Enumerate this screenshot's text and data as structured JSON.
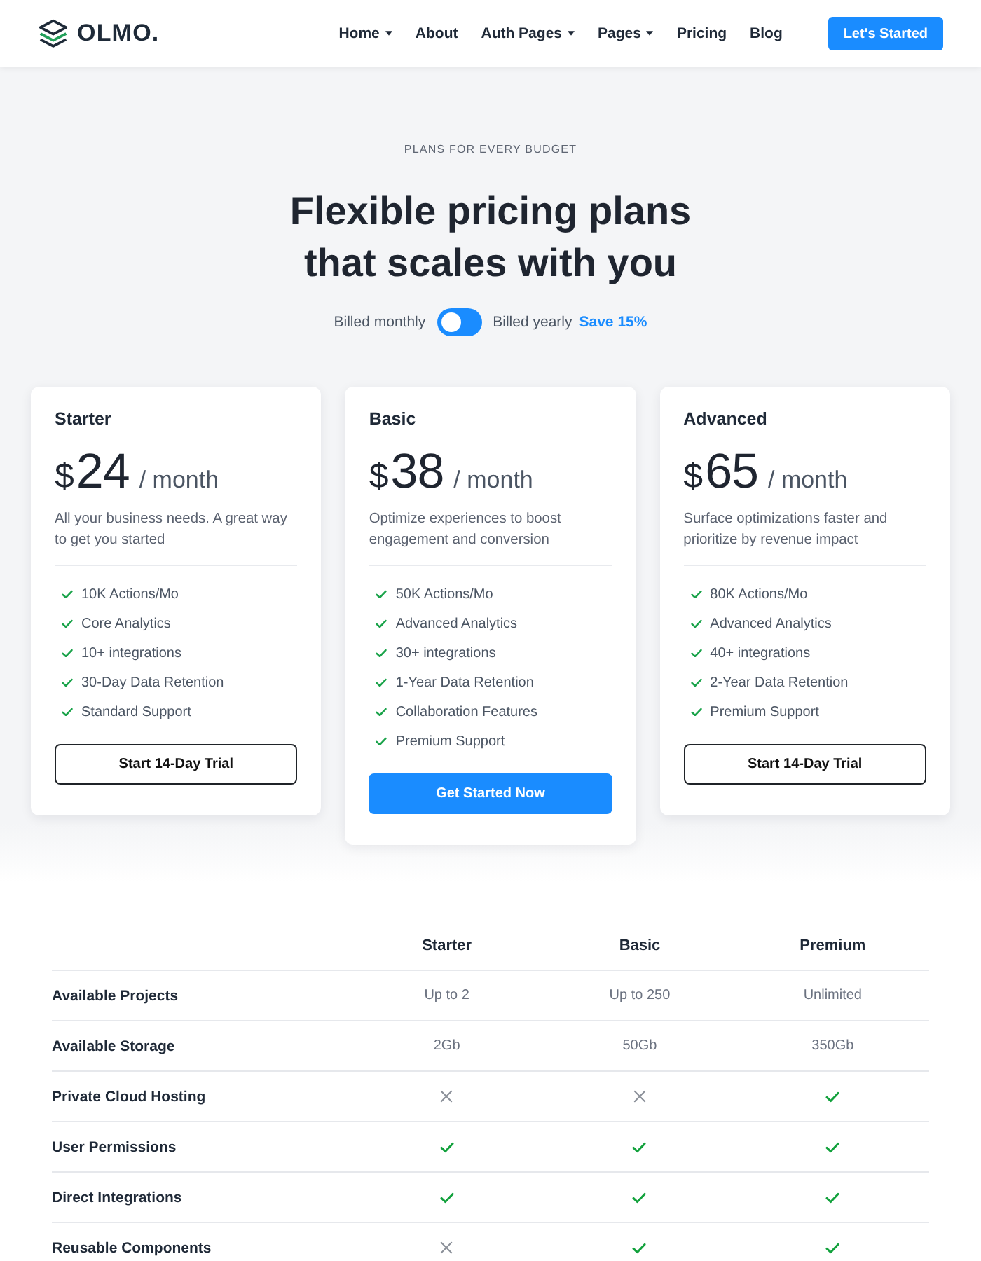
{
  "nav": {
    "logo": "OLMO.",
    "items": [
      {
        "label": "Home",
        "dropdown": true
      },
      {
        "label": "About",
        "dropdown": false
      },
      {
        "label": "Auth Pages",
        "dropdown": true
      },
      {
        "label": "Pages",
        "dropdown": true
      },
      {
        "label": "Pricing",
        "dropdown": false
      },
      {
        "label": "Blog",
        "dropdown": false
      }
    ],
    "cta": "Let's Started"
  },
  "hero": {
    "eyebrow": "PLANS FOR EVERY BUDGET",
    "title_lines": [
      "Flexible pricing plans",
      "that scales with you"
    ],
    "billing": {
      "monthly_label": "Billed monthly",
      "switch_on": false,
      "yearly_label": "Billed yearly",
      "save": "Save 15%"
    }
  },
  "plans": [
    {
      "name": "Starter",
      "currency": "$",
      "amount": "24",
      "period": "/ month",
      "description": "All your business needs. A great way to get you started",
      "features": [
        "10K Actions/Mo",
        "Core Analytics",
        "10+ integrations",
        "30-Day Data Retention",
        "Standard Support"
      ],
      "button": {
        "label": "Start 14-Day Trial",
        "kind": "outline"
      }
    },
    {
      "name": "Basic",
      "currency": "$",
      "amount": "38",
      "period": "/ month",
      "description": "Optimize experiences to boost engagement and conversion",
      "features": [
        "50K Actions/Mo",
        "Advanced Analytics",
        "30+ integrations",
        "1-Year Data Retention",
        "Collaboration Features",
        "Premium Support"
      ],
      "button": {
        "label": "Get Started Now",
        "kind": "primary"
      }
    },
    {
      "name": "Advanced",
      "currency": "$",
      "amount": "65",
      "period": "/ month",
      "description": "Surface optimizations faster and prioritize by revenue impact",
      "features": [
        "80K Actions/Mo",
        "Advanced Analytics",
        "40+ integrations",
        "2-Year Data Retention",
        "Premium Support"
      ],
      "button": {
        "label": "Start 14-Day Trial",
        "kind": "outline"
      }
    }
  ],
  "comparison": {
    "columns": [
      "Starter",
      "Basic",
      "Premium"
    ],
    "rows": [
      {
        "label": "Available Projects",
        "cells": [
          {
            "kind": "text",
            "text": "Up to 2"
          },
          {
            "kind": "text",
            "text": "Up to 250"
          },
          {
            "kind": "text",
            "text": "Unlimited"
          }
        ]
      },
      {
        "label": "Available Storage",
        "cells": [
          {
            "kind": "text",
            "text": "2Gb"
          },
          {
            "kind": "text",
            "text": "50Gb"
          },
          {
            "kind": "text",
            "text": "350Gb"
          }
        ]
      },
      {
        "label": "Private Cloud Hosting",
        "cells": [
          {
            "kind": "cross"
          },
          {
            "kind": "cross"
          },
          {
            "kind": "check"
          }
        ]
      },
      {
        "label": "User Permissions",
        "cells": [
          {
            "kind": "check"
          },
          {
            "kind": "check"
          },
          {
            "kind": "check"
          }
        ]
      },
      {
        "label": "Direct Integrations",
        "cells": [
          {
            "kind": "check"
          },
          {
            "kind": "check"
          },
          {
            "kind": "check"
          }
        ]
      },
      {
        "label": "Reusable Components",
        "cells": [
          {
            "kind": "cross"
          },
          {
            "kind": "check"
          },
          {
            "kind": "check"
          }
        ]
      }
    ]
  }
}
